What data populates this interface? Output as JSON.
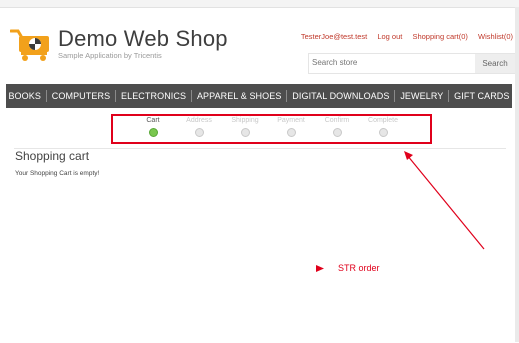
{
  "header": {
    "logo_title": "Demo Web Shop",
    "logo_subtitle": "Sample Application by Tricentis",
    "links": {
      "account": "TesterJoe@test.test",
      "logout": "Log out",
      "cart": "Shopping cart(0)",
      "wishlist": "Wishlist(0)"
    },
    "search": {
      "placeholder": "Search store",
      "button": "Search"
    },
    "accent": "#c0392b"
  },
  "menu": {
    "items": [
      "BOOKS",
      "COMPUTERS",
      "ELECTRONICS",
      "APPAREL & SHOES",
      "DIGITAL DOWNLOADS",
      "JEWELRY",
      "GIFT CARDS"
    ],
    "background": "#4d4d4d"
  },
  "progress": {
    "steps": [
      "Cart",
      "Address",
      "Shipping",
      "Payment",
      "Confirm",
      "Complete"
    ],
    "active_index": 0
  },
  "main": {
    "title": "Shopping cart",
    "empty_message": "Your Shopping Cart is empty!"
  },
  "annotation": {
    "label": "STR order",
    "color": "#e0001b"
  },
  "icons": {
    "logo": "shopping-cart-icon",
    "annotation_marker": "triangle-right-icon"
  }
}
